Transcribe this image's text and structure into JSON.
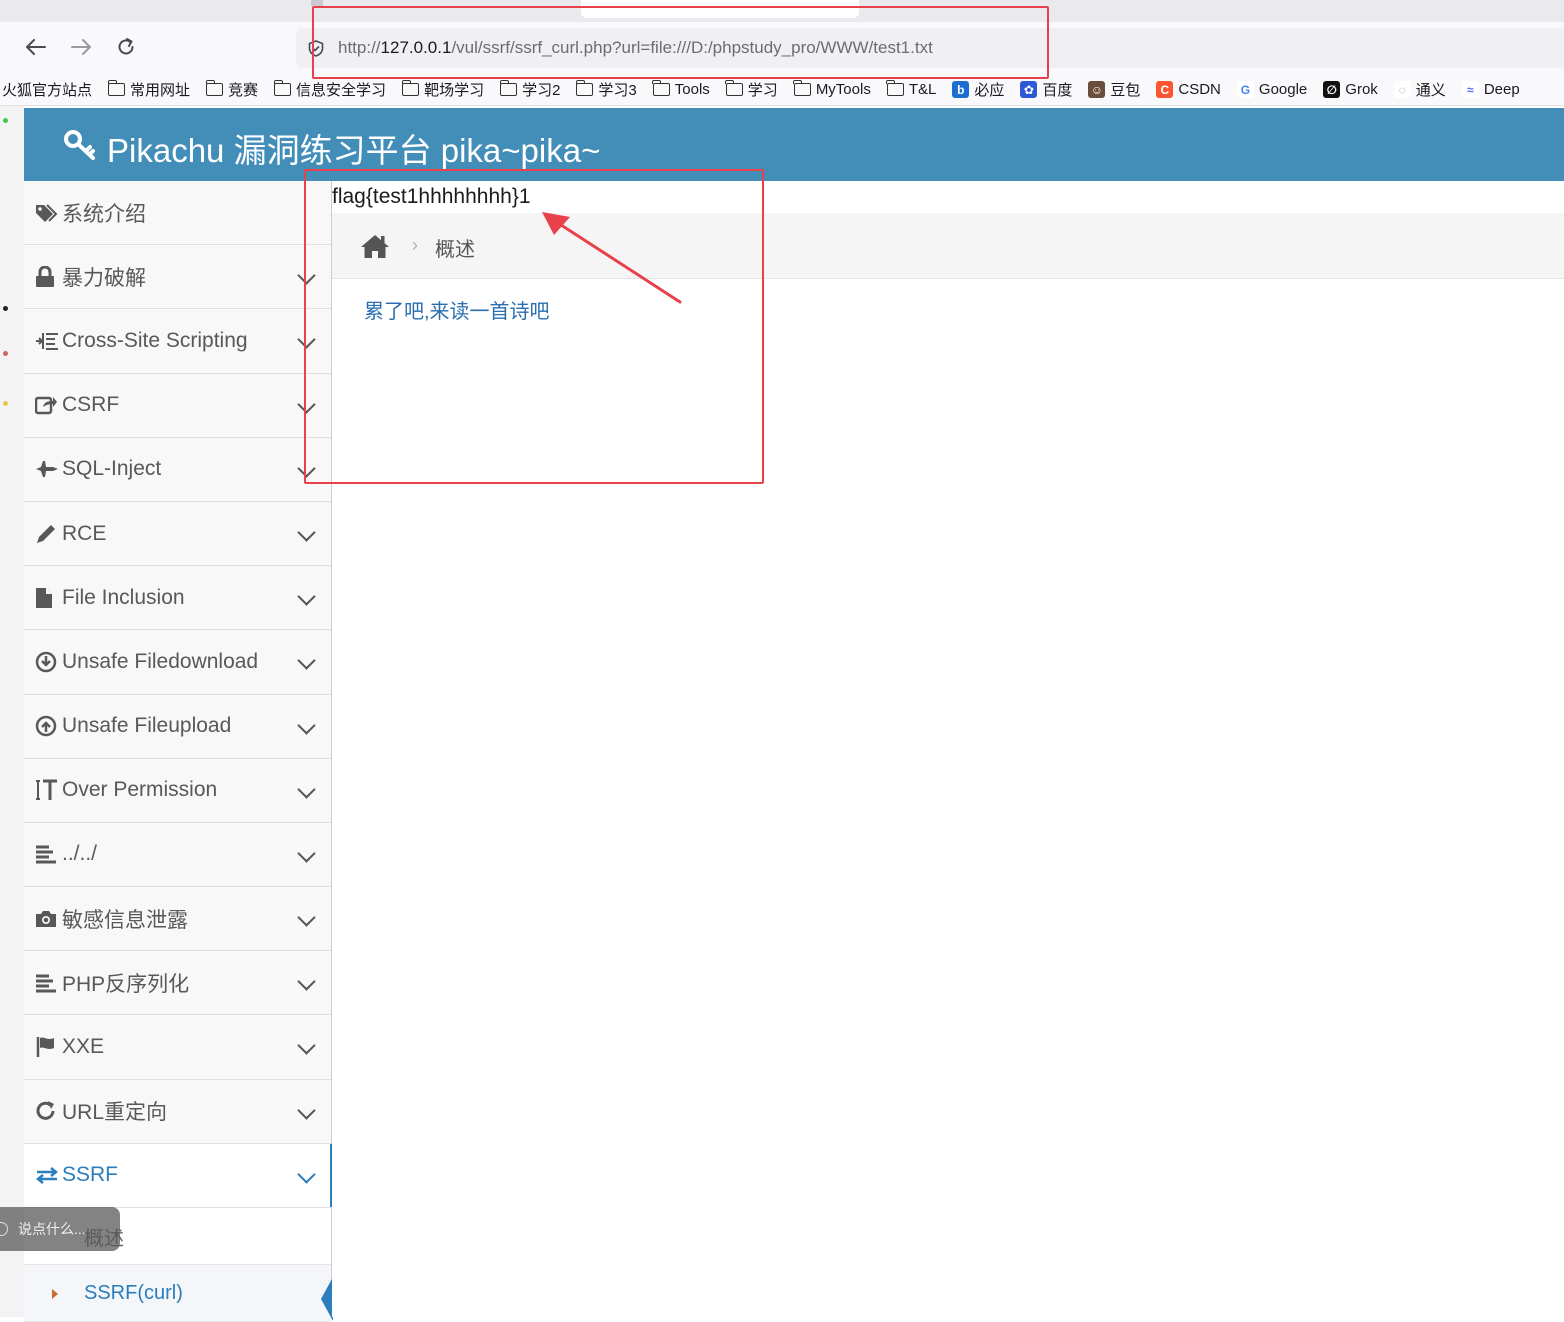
{
  "browser": {
    "url_prefix": "http://",
    "url_host": "127.0.0.1",
    "url_path": "/vul/ssrf/ssrf_curl.php?url=file:///D:/phpstudy_pro/WWW/test1.txt",
    "back_icon": "arrow-left",
    "forward_icon": "arrow-right",
    "reload_icon": "reload",
    "bookmarks": [
      {
        "label": "火狐官方站点",
        "icon": "none"
      },
      {
        "label": "常用网址",
        "icon": "folder"
      },
      {
        "label": "竞赛",
        "icon": "folder"
      },
      {
        "label": "信息安全学习",
        "icon": "folder"
      },
      {
        "label": "靶场学习",
        "icon": "folder"
      },
      {
        "label": "学习2",
        "icon": "folder"
      },
      {
        "label": "学习3",
        "icon": "folder"
      },
      {
        "label": "Tools",
        "icon": "folder"
      },
      {
        "label": "学习",
        "icon": "folder"
      },
      {
        "label": "MyTools",
        "icon": "folder"
      },
      {
        "label": "T&L",
        "icon": "folder"
      },
      {
        "label": "必应",
        "icon": "bing"
      },
      {
        "label": "百度",
        "icon": "baidu"
      },
      {
        "label": "豆包",
        "icon": "doubao"
      },
      {
        "label": "CSDN",
        "icon": "csdn"
      },
      {
        "label": "Google",
        "icon": "google"
      },
      {
        "label": "Grok",
        "icon": "grok"
      },
      {
        "label": "通义",
        "icon": "tongyi"
      },
      {
        "label": "Deep",
        "icon": "deepseek"
      }
    ]
  },
  "header": {
    "title": "Pikachu 漏洞练习平台 pika~pika~",
    "icon": "key-icon",
    "bg_color": "#438eb9"
  },
  "sidebar": {
    "items": [
      {
        "label": "系统介绍",
        "icon": "tags",
        "has_chevron": false
      },
      {
        "label": "暴力破解",
        "icon": "lock",
        "has_chevron": true
      },
      {
        "label": "Cross-Site Scripting",
        "icon": "indent",
        "has_chevron": true
      },
      {
        "label": "CSRF",
        "icon": "share",
        "has_chevron": true
      },
      {
        "label": "SQL-Inject",
        "icon": "fighter-jet",
        "has_chevron": true
      },
      {
        "label": "RCE",
        "icon": "pencil",
        "has_chevron": true
      },
      {
        "label": "File Inclusion",
        "icon": "file",
        "has_chevron": true
      },
      {
        "label": "Unsafe Filedownload",
        "icon": "download-circle",
        "has_chevron": true
      },
      {
        "label": "Unsafe Fileupload",
        "icon": "upload-circle",
        "has_chevron": true
      },
      {
        "label": "Over Permission",
        "icon": "text-height",
        "has_chevron": true
      },
      {
        "label": "../../",
        "icon": "align-left",
        "has_chevron": true
      },
      {
        "label": "敏感信息泄露",
        "icon": "camera",
        "has_chevron": true
      },
      {
        "label": "PHP反序列化",
        "icon": "align-left",
        "has_chevron": true
      },
      {
        "label": "XXE",
        "icon": "flag",
        "has_chevron": true
      },
      {
        "label": "URL重定向",
        "icon": "repeat",
        "has_chevron": true
      },
      {
        "label": "SSRF",
        "icon": "exchange",
        "has_chevron": true,
        "active": true
      }
    ],
    "sub_items": [
      {
        "label": "概述",
        "active": false
      },
      {
        "label": "SSRF(curl)",
        "active": true
      }
    ],
    "accent_color": "#2b7dbc"
  },
  "chat": {
    "placeholder": "说点什么..."
  },
  "main": {
    "flag_output": "flag{test1hhhhhhhh}1",
    "breadcrumb": "概述",
    "poem_link": "累了吧,来读一首诗吧"
  },
  "annotation_color": "#e8414b"
}
